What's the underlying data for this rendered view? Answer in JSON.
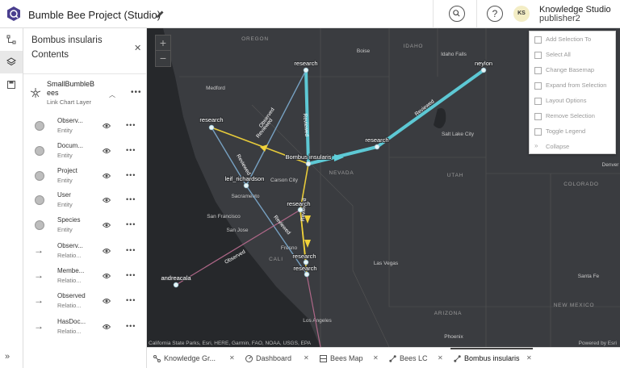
{
  "header": {
    "title": "Bumble Bee Project (Studio)",
    "org": "Knowledge Studio",
    "user": "publisher2",
    "avatar_initials": "KS"
  },
  "panel": {
    "title": "Bombus insularis",
    "subtitle": "Contents",
    "layer": {
      "name": "SmallBumbleBees",
      "type": "Link Chart Layer"
    },
    "items": [
      {
        "name": "Observ...",
        "type": "Entity",
        "symbol": "circle"
      },
      {
        "name": "Docum...",
        "type": "Entity",
        "symbol": "circle"
      },
      {
        "name": "Project",
        "type": "Entity",
        "symbol": "circle"
      },
      {
        "name": "User",
        "type": "Entity",
        "symbol": "circle"
      },
      {
        "name": "Species",
        "type": "Entity",
        "symbol": "circle"
      },
      {
        "name": "Observ...",
        "type": "Relatio...",
        "symbol": "arrow"
      },
      {
        "name": "Membe...",
        "type": "Relatio...",
        "symbol": "arrow"
      },
      {
        "name": "Observed",
        "type": "Relatio...",
        "symbol": "arrow"
      },
      {
        "name": "HasDoc...",
        "type": "Relatio...",
        "symbol": "arrow"
      }
    ]
  },
  "map": {
    "attribution": "California State Parks, Esri, HERE, Garmin, FAO, NOAA, USGS, EPA",
    "powered": "Powered by Esri",
    "places": [
      {
        "label": "OREGON",
        "kind": "state"
      },
      {
        "label": "IDAHO",
        "kind": "state"
      },
      {
        "label": "NEVADA",
        "kind": "state"
      },
      {
        "label": "UTAH",
        "kind": "state"
      },
      {
        "label": "COLORADO",
        "kind": "state"
      },
      {
        "label": "ARIZONA",
        "kind": "state"
      },
      {
        "label": "NEW MEXICO",
        "kind": "state"
      },
      {
        "label": "Boise",
        "kind": "city"
      },
      {
        "label": "Idaho Falls",
        "kind": "city"
      },
      {
        "label": "Medford",
        "kind": "city"
      },
      {
        "label": "Salt Lake City",
        "kind": "city"
      },
      {
        "label": "Carson City",
        "kind": "city"
      },
      {
        "label": "Sacramento",
        "kind": "city"
      },
      {
        "label": "San Francisco",
        "kind": "city"
      },
      {
        "label": "San Jose",
        "kind": "city"
      },
      {
        "label": "Fresno",
        "kind": "city"
      },
      {
        "label": "Las Vegas",
        "kind": "city"
      },
      {
        "label": "Los Angeles",
        "kind": "city"
      },
      {
        "label": "Phoenix",
        "kind": "city"
      },
      {
        "label": "Santa Fe",
        "kind": "city"
      },
      {
        "label": "Denver",
        "kind": "city"
      },
      {
        "label": "CALI",
        "kind": "state"
      }
    ],
    "nodes": [
      {
        "id": "n1",
        "label": "research"
      },
      {
        "id": "n2",
        "label": "neylon"
      },
      {
        "id": "n3",
        "label": "research"
      },
      {
        "id": "n4",
        "label": "research"
      },
      {
        "id": "n5",
        "label": "Bombus insularis"
      },
      {
        "id": "n6",
        "label": "leif_richardson"
      },
      {
        "id": "n7",
        "label": "research"
      },
      {
        "id": "n8",
        "label": "research"
      },
      {
        "id": "n9",
        "label": "research"
      },
      {
        "id": "n10",
        "label": "andreacala"
      }
    ],
    "edge_labels": [
      "Observed",
      "Reviewed",
      "Reviewed",
      "Reviewed",
      "Reviewed",
      "Reviewed",
      "Observed",
      "Reviewed"
    ],
    "colors": {
      "cyan": "#5fd0dc",
      "yellow": "#f0d23a",
      "blue": "#7aa6c8",
      "pink": "#b56a8c"
    }
  },
  "context_menu": [
    "Add Selection To",
    "Select All",
    "Change Basemap",
    "Expand from Selection",
    "Layout Options",
    "Remove Selection",
    "Toggle Legend",
    "Collapse"
  ],
  "tabs": [
    {
      "label": "Knowledge Gr...",
      "icon": "knowledge-graph-icon"
    },
    {
      "label": "Dashboard",
      "icon": "dashboard-icon"
    },
    {
      "label": "Bees Map",
      "icon": "map-icon"
    },
    {
      "label": "Bees LC",
      "icon": "link-chart-icon"
    },
    {
      "label": "Bombus insularis",
      "icon": "link-chart-icon",
      "active": true
    }
  ]
}
